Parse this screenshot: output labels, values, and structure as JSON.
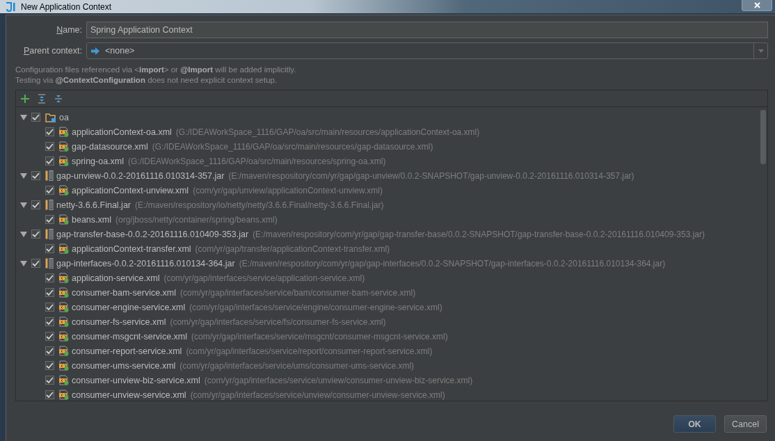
{
  "window": {
    "title": "New Application Context"
  },
  "name_field": {
    "label": "Name:",
    "value": "Spring Application Context"
  },
  "parent_context": {
    "label": "Parent context:",
    "value": "<none>"
  },
  "hints": [
    "Configuration files referenced via <**import**> or **@Import** will be added implicitly.",
    "Testing via **@ContextConfiguration** does not need explicit context setup."
  ],
  "tree": [
    {
      "kind": "folder",
      "label": "oa",
      "checked": true,
      "expanded": true,
      "children": [
        {
          "kind": "xml",
          "label": "applicationContext-oa.xml",
          "path": "(G:/IDEAWorkSpace_1116/GAP/oa/src/main/resources/applicationContext-oa.xml)",
          "checked": true
        },
        {
          "kind": "xml",
          "label": "gap-datasource.xml",
          "path": "(G:/IDEAWorkSpace_1116/GAP/oa/src/main/resources/gap-datasource.xml)",
          "checked": true
        },
        {
          "kind": "xml",
          "label": "spring-oa.xml",
          "path": "(G:/IDEAWorkSpace_1116/GAP/oa/src/main/resources/spring-oa.xml)",
          "checked": true
        }
      ]
    },
    {
      "kind": "jar",
      "label": "gap-unview-0.0.2-20161116.010314-357.jar",
      "path": "(E:/maven/respository/com/yr/gap/gap-unview/0.0.2-SNAPSHOT/gap-unview-0.0.2-20161116.010314-357.jar)",
      "checked": true,
      "expanded": true,
      "children": [
        {
          "kind": "xml",
          "label": "applicationContext-unview.xml",
          "path": "(com/yr/gap/unview/applicationContext-unview.xml)",
          "checked": true
        }
      ]
    },
    {
      "kind": "jar",
      "label": "netty-3.6.6.Final.jar",
      "path": "(E:/maven/respository/io/netty/netty/3.6.6.Final/netty-3.6.6.Final.jar)",
      "checked": true,
      "expanded": true,
      "children": [
        {
          "kind": "xml",
          "label": "beans.xml",
          "path": "(org/jboss/netty/container/spring/beans.xml)",
          "checked": true
        }
      ]
    },
    {
      "kind": "jar",
      "label": "gap-transfer-base-0.0.2-20161116.010409-353.jar",
      "path": "(E:/maven/respository/com/yr/gap/gap-transfer-base/0.0.2-SNAPSHOT/gap-transfer-base-0.0.2-20161116.010409-353.jar)",
      "checked": true,
      "expanded": true,
      "children": [
        {
          "kind": "xml",
          "label": "applicationContext-transfer.xml",
          "path": "(com/yr/gap/transfer/applicationContext-transfer.xml)",
          "checked": true
        }
      ]
    },
    {
      "kind": "jar",
      "label": "gap-interfaces-0.0.2-20161116.010134-364.jar",
      "path": "(E:/maven/respository/com/yr/gap/gap-interfaces/0.0.2-SNAPSHOT/gap-interfaces-0.0.2-20161116.010134-364.jar)",
      "checked": true,
      "expanded": true,
      "children": [
        {
          "kind": "xml",
          "label": "application-service.xml",
          "path": "(com/yr/gap/interfaces/service/application-service.xml)",
          "checked": true
        },
        {
          "kind": "xml",
          "label": "consumer-bam-service.xml",
          "path": "(com/yr/gap/interfaces/service/bam/consumer-bam-service.xml)",
          "checked": true
        },
        {
          "kind": "xml",
          "label": "consumer-engine-service.xml",
          "path": "(com/yr/gap/interfaces/service/engine/consumer-engine-service.xml)",
          "checked": true
        },
        {
          "kind": "xml",
          "label": "consumer-fs-service.xml",
          "path": "(com/yr/gap/interfaces/service/fs/consumer-fs-service.xml)",
          "checked": true
        },
        {
          "kind": "xml",
          "label": "consumer-msgcnt-service.xml",
          "path": "(com/yr/gap/interfaces/service/msgcnt/consumer-msgcnt-service.xml)",
          "checked": true
        },
        {
          "kind": "xml",
          "label": "consumer-report-service.xml",
          "path": "(com/yr/gap/interfaces/service/report/consumer-report-service.xml)",
          "checked": true
        },
        {
          "kind": "xml",
          "label": "consumer-ums-service.xml",
          "path": "(com/yr/gap/interfaces/service/ums/consumer-ums-service.xml)",
          "checked": true
        },
        {
          "kind": "xml",
          "label": "consumer-unview-biz-service.xml",
          "path": "(com/yr/gap/interfaces/service/unview/consumer-unview-biz-service.xml)",
          "checked": true
        },
        {
          "kind": "xml",
          "label": "consumer-unview-service.xml",
          "path": "(com/yr/gap/interfaces/service/unview/consumer-unview-service.xml)",
          "checked": true
        }
      ]
    }
  ],
  "buttons": [
    {
      "label": "OK",
      "kind": "primary"
    },
    {
      "label": "Cancel",
      "kind": "secondary"
    }
  ]
}
